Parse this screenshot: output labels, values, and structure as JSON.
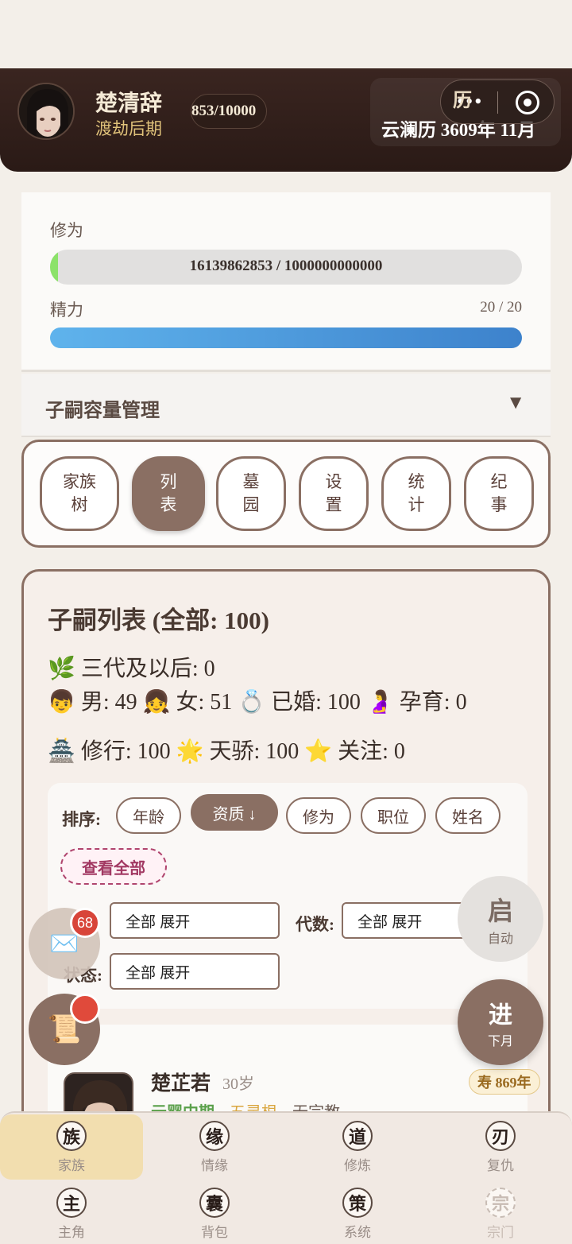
{
  "header": {
    "name": "楚清辞",
    "realm": "渡劫后期",
    "exp_pill": "853/10000",
    "calendar_icon": "历",
    "calendar_text": "云澜历 3609年 11月",
    "capsule_dots": "•••"
  },
  "stats": {
    "xiuwei_label": "修为",
    "xiuwei_value": "16139862853 / 1000000000000",
    "xiuwei_fraction": 0.016,
    "energy_label": "精力",
    "energy_value": "20 / 20",
    "energy_fraction": 1.0
  },
  "capacity": {
    "title": "子嗣容量管理",
    "arrow": "▼"
  },
  "tabs": [
    {
      "label": "家族\n树"
    },
    {
      "label": "列\n表"
    },
    {
      "label": "墓\n园"
    },
    {
      "label": "设\n置"
    },
    {
      "label": "统\n计"
    },
    {
      "label": "纪\n事"
    }
  ],
  "list": {
    "title": "子嗣列表 (全部: 100)",
    "line1": "🌿 三代及以后: 0",
    "line2": "👦 男: 49  👧 女: 51  💍 已婚: 100  🤰 孕育: 0",
    "line3": "🏯 修行: 100  🌟 天骄: 100  ⭐ 关注: 0"
  },
  "sort": {
    "label": "排序:",
    "chips": [
      "年龄",
      "资质 ↓",
      "修为",
      "职位",
      "姓名"
    ],
    "view_all": "查看全部",
    "filter1_value": "全部 展开",
    "gen_label": "代数:",
    "gen_value": "全部 展开",
    "status_label": "状态:",
    "status_value": "全部 展开"
  },
  "child": {
    "name": "楚芷若",
    "age": "30岁",
    "tag1": "元婴中期",
    "tag2": "五灵根",
    "tag3": "无宗教",
    "life": "寿 869年"
  },
  "fabs": {
    "mail_icon": "✉️",
    "mail_count": "68",
    "scroll_icon": "📜",
    "auto_big": "启",
    "auto_small": "自动",
    "next_big": "进",
    "next_small": "下月"
  },
  "nav": [
    {
      "glyph": "族",
      "label": "家族"
    },
    {
      "glyph": "缘",
      "label": "情缘"
    },
    {
      "glyph": "道",
      "label": "修炼"
    },
    {
      "glyph": "刃",
      "label": "复仇"
    },
    {
      "glyph": "主",
      "label": "主角"
    },
    {
      "glyph": "囊",
      "label": "背包"
    },
    {
      "glyph": "策",
      "label": "系统"
    },
    {
      "glyph": "宗",
      "label": "宗门"
    }
  ],
  "colors": {
    "accent": "#8a6f63",
    "header_bg": "#2a1a16",
    "xiuwei_fill": "#8ce26a",
    "energy_fill": "#3d82cc",
    "badge_red": "#d8453a"
  }
}
